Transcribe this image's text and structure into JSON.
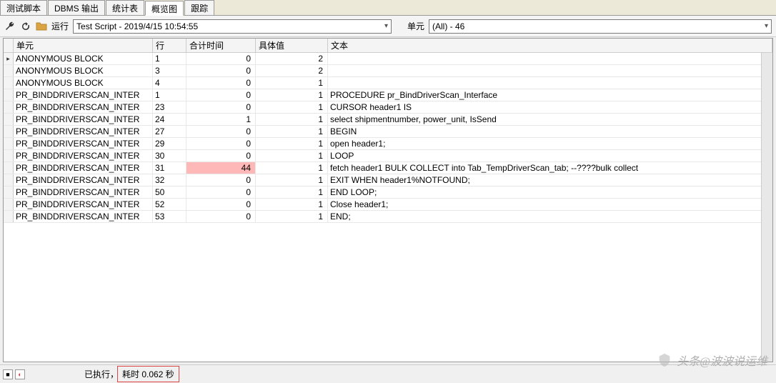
{
  "tabs": {
    "items": [
      "测试脚本",
      "DBMS 输出",
      "统计表",
      "概览图",
      "跟踪"
    ],
    "active_index": 3
  },
  "toolbar": {
    "run_label": "运行",
    "script_dropdown": "Test Script - 2019/4/15 10:54:55",
    "unit_label": "单元",
    "unit_dropdown": "(All) - 46"
  },
  "grid": {
    "headers": {
      "unit": "单元",
      "line": "行",
      "total_time": "合计时间",
      "value": "具体值",
      "text": "文本"
    },
    "rows": [
      {
        "ind": "▸",
        "unit": "ANONYMOUS BLOCK",
        "line": "1",
        "total": "0",
        "val": "2",
        "text": "",
        "hl": false
      },
      {
        "ind": "",
        "unit": "ANONYMOUS BLOCK",
        "line": "3",
        "total": "0",
        "val": "2",
        "text": "",
        "hl": false
      },
      {
        "ind": "",
        "unit": "ANONYMOUS BLOCK",
        "line": "4",
        "total": "0",
        "val": "1",
        "text": "",
        "hl": false
      },
      {
        "ind": "",
        "unit": "PR_BINDDRIVERSCAN_INTER",
        "line": "1",
        "total": "0",
        "val": "1",
        "text": "PROCEDURE pr_BindDriverScan_Interface",
        "hl": false
      },
      {
        "ind": "",
        "unit": "PR_BINDDRIVERSCAN_INTER",
        "line": "23",
        "total": "0",
        "val": "1",
        "text": "CURSOR header1 IS",
        "hl": false
      },
      {
        "ind": "",
        "unit": "PR_BINDDRIVERSCAN_INTER",
        "line": "24",
        "total": "1",
        "val": "1",
        "text": "select shipmentnumber, power_unit, IsSend",
        "hl": false
      },
      {
        "ind": "",
        "unit": "PR_BINDDRIVERSCAN_INTER",
        "line": "27",
        "total": "0",
        "val": "1",
        "text": "BEGIN",
        "hl": false
      },
      {
        "ind": "",
        "unit": "PR_BINDDRIVERSCAN_INTER",
        "line": "29",
        "total": "0",
        "val": "1",
        "text": "open header1;",
        "hl": false
      },
      {
        "ind": "",
        "unit": "PR_BINDDRIVERSCAN_INTER",
        "line": "30",
        "total": "0",
        "val": "1",
        "text": "LOOP",
        "hl": false
      },
      {
        "ind": "",
        "unit": "PR_BINDDRIVERSCAN_INTER",
        "line": "31",
        "total": "44",
        "val": "1",
        "text": "fetch header1 BULK COLLECT into Tab_TempDriverScan_tab;  --????bulk collect",
        "hl": true
      },
      {
        "ind": "",
        "unit": "PR_BINDDRIVERSCAN_INTER",
        "line": "32",
        "total": "0",
        "val": "1",
        "text": "EXIT WHEN header1%NOTFOUND;",
        "hl": false
      },
      {
        "ind": "",
        "unit": "PR_BINDDRIVERSCAN_INTER",
        "line": "50",
        "total": "0",
        "val": "1",
        "text": "END LOOP;",
        "hl": false
      },
      {
        "ind": "",
        "unit": "PR_BINDDRIVERSCAN_INTER",
        "line": "52",
        "total": "0",
        "val": "1",
        "text": "Close header1;",
        "hl": false
      },
      {
        "ind": "",
        "unit": "PR_BINDDRIVERSCAN_INTER",
        "line": "53",
        "total": "0",
        "val": "1",
        "text": "END;",
        "hl": false
      }
    ]
  },
  "status": {
    "executed": "已执行，",
    "elapsed": "耗时 0.062 秒"
  },
  "watermark": "头条@波波说运维"
}
